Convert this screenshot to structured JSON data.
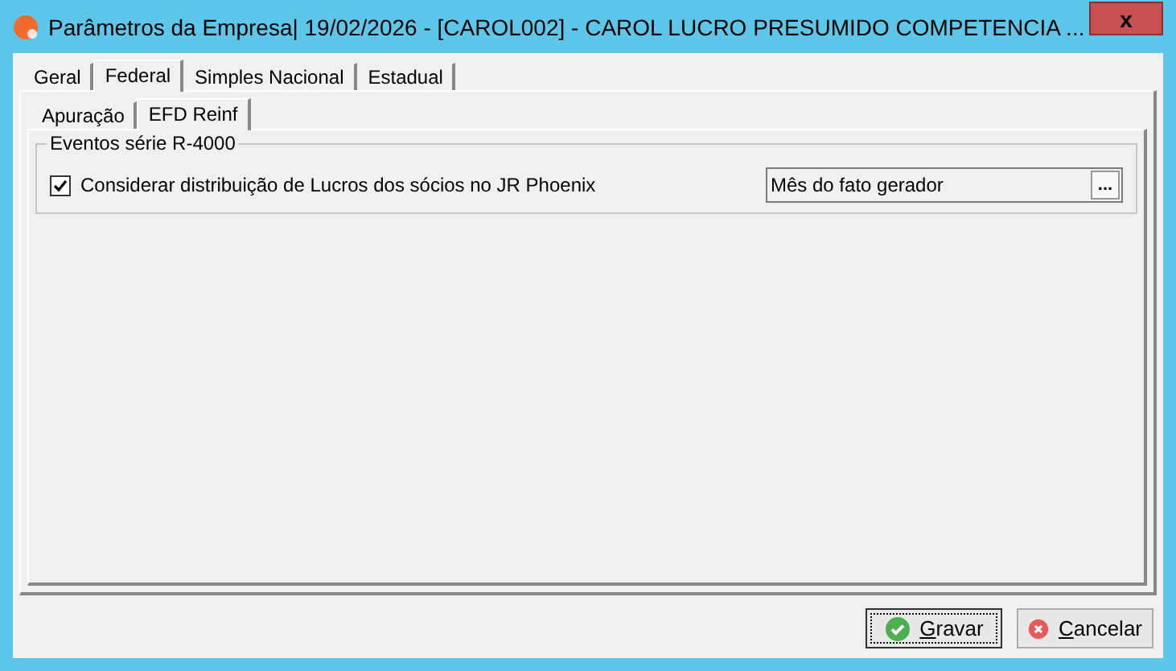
{
  "window": {
    "title": "Parâmetros da Empresa|  19/02/2026 - [CAROL002] - CAROL LUCRO PRESUMIDO COMPETENCIA ...",
    "close": "x"
  },
  "tabs": [
    {
      "label": "Geral",
      "selected": false
    },
    {
      "label": "Federal",
      "selected": true
    },
    {
      "label": "Simples Nacional",
      "selected": false
    },
    {
      "label": "Estadual",
      "selected": false
    }
  ],
  "subtabs": [
    {
      "label": "Apuração",
      "selected": false
    },
    {
      "label": "EFD Reinf",
      "selected": true
    }
  ],
  "group": {
    "title": "Eventos série R-4000",
    "option": {
      "label": "Considerar distribuição de Lucros dos sócios no JR Phoenix",
      "checked": true
    },
    "field": {
      "value": "Mês do fato gerador",
      "button": "..."
    }
  },
  "buttons": [
    {
      "label": "Gravar",
      "kind": "ok",
      "focused": true
    },
    {
      "label": "Cancelar",
      "kind": "cancel",
      "focused": false
    }
  ]
}
